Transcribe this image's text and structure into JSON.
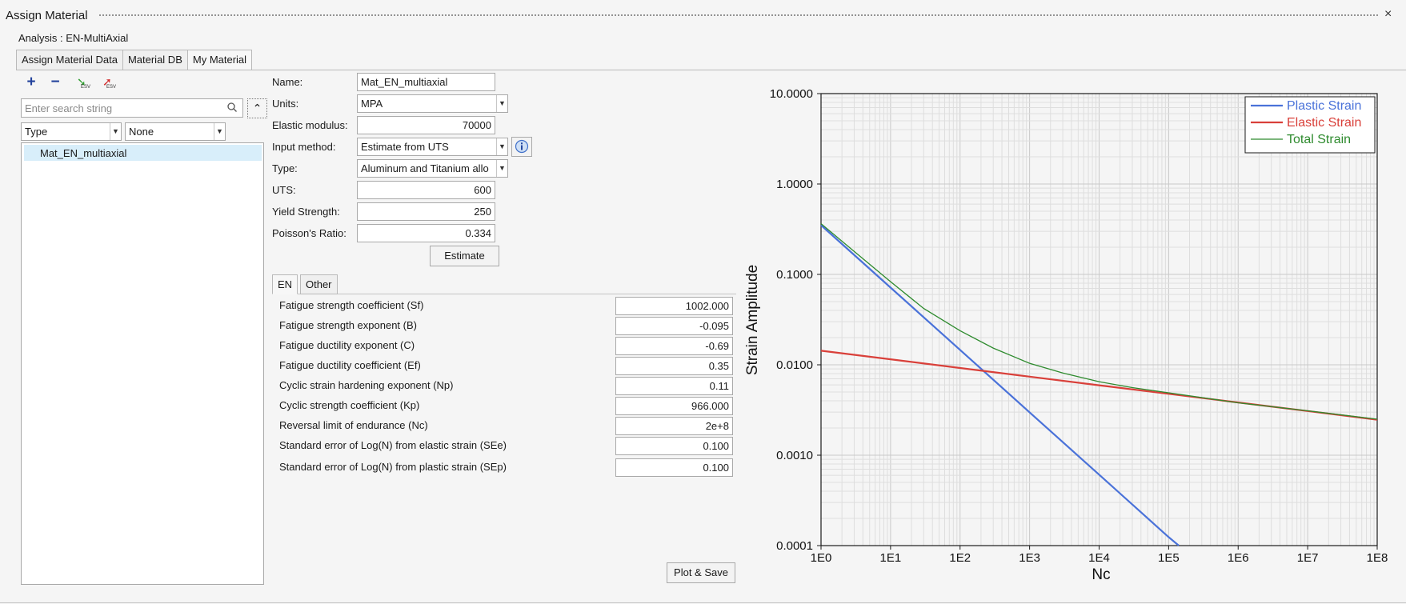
{
  "window": {
    "title": "Assign Material",
    "close": "×"
  },
  "analysis": "Analysis : EN-MultiAxial",
  "tabs": [
    {
      "label": "Assign Material Data"
    },
    {
      "label": "Material DB"
    },
    {
      "label": "My Material"
    }
  ],
  "toolbar": {
    "add": "+",
    "remove": "−",
    "esv_label": "ESV"
  },
  "search": {
    "placeholder": "Enter search string",
    "collapse": "⌃"
  },
  "filters": {
    "type": "Type",
    "value": "None"
  },
  "materials": [
    {
      "name": "Mat_EN_multiaxial"
    }
  ],
  "props": {
    "name": {
      "label": "Name:",
      "value": "Mat_EN_multiaxial"
    },
    "units": {
      "label": "Units:",
      "value": "MPA"
    },
    "elastic_modulus": {
      "label": "Elastic modulus:",
      "value": "70000"
    },
    "input_method": {
      "label": "Input method:",
      "value": "Estimate from UTS"
    },
    "type": {
      "label": "Type:",
      "value": "Aluminum and Titanium allo"
    },
    "uts": {
      "label": "UTS:",
      "value": "600"
    },
    "yield_strength": {
      "label": "Yield Strength:",
      "value": "250"
    },
    "poisson": {
      "label": "Poisson's Ratio:",
      "value": "0.334"
    },
    "estimate_btn": "Estimate"
  },
  "subtabs": [
    {
      "label": "EN"
    },
    {
      "label": "Other"
    }
  ],
  "en_params": [
    {
      "label": "Fatigue strength coefficient (Sf)",
      "value": "1002.000"
    },
    {
      "label": "Fatigue strength exponent (B)",
      "value": "-0.095"
    },
    {
      "label": "Fatigue ductility exponent (C)",
      "value": "-0.69"
    },
    {
      "label": "Fatigue ductility coefficient (Ef)",
      "value": "0.35"
    },
    {
      "label": "Cyclic strain hardening exponent (Np)",
      "value": "0.11"
    },
    {
      "label": "Cyclic strength coefficient (Kp)",
      "value": "966.000"
    },
    {
      "label": "Reversal limit of endurance (Nc)",
      "value": "2e+8"
    },
    {
      "label": "Standard error of Log(N) from elastic strain (SEe)",
      "value": "0.100"
    },
    {
      "label": "Standard error of Log(N) from plastic strain (SEp)",
      "value": "0.100"
    }
  ],
  "plot_save_btn": "Plot & Save",
  "chart_data": {
    "type": "line",
    "xlabel": "Nc",
    "ylabel": "Strain Amplitude",
    "xscale": "log",
    "yscale": "log",
    "xlim": [
      1,
      100000000
    ],
    "ylim": [
      0.0001,
      10
    ],
    "grid": true,
    "legend_position": "top-right",
    "x_ticks": [
      "1E0",
      "1E1",
      "1E2",
      "1E3",
      "1E4",
      "1E5",
      "1E6",
      "1E7",
      "1E8"
    ],
    "y_ticks": [
      "10.0000",
      "1.0000",
      "0.1000",
      "0.0100",
      "0.0010",
      "0.0001"
    ],
    "series": [
      {
        "name": "Plastic Strain",
        "color": "#4a72d9",
        "x": [
          1,
          10,
          100,
          1000,
          10000,
          100000,
          140000
        ],
        "y": [
          0.35,
          0.0715,
          0.0146,
          0.00298,
          0.000609,
          0.000124,
          0.0001
        ]
      },
      {
        "name": "Elastic Strain",
        "color": "#d9403a",
        "x": [
          1,
          10,
          100,
          1000,
          10000,
          100000,
          1000000,
          10000000,
          100000000
        ],
        "y": [
          0.0143,
          0.0115,
          0.00921,
          0.0074,
          0.00594,
          0.00477,
          0.00383,
          0.00308,
          0.00247
        ]
      },
      {
        "name": "Total Strain",
        "color": "#2e8b2e",
        "x": [
          1,
          3,
          10,
          30,
          100,
          300,
          1000,
          3000,
          10000,
          30000,
          100000,
          1000000,
          10000000,
          100000000
        ],
        "y": [
          0.364,
          0.18,
          0.083,
          0.042,
          0.0238,
          0.0153,
          0.0104,
          0.0081,
          0.0065,
          0.0056,
          0.0049,
          0.0038,
          0.0031,
          0.0025
        ]
      }
    ]
  }
}
